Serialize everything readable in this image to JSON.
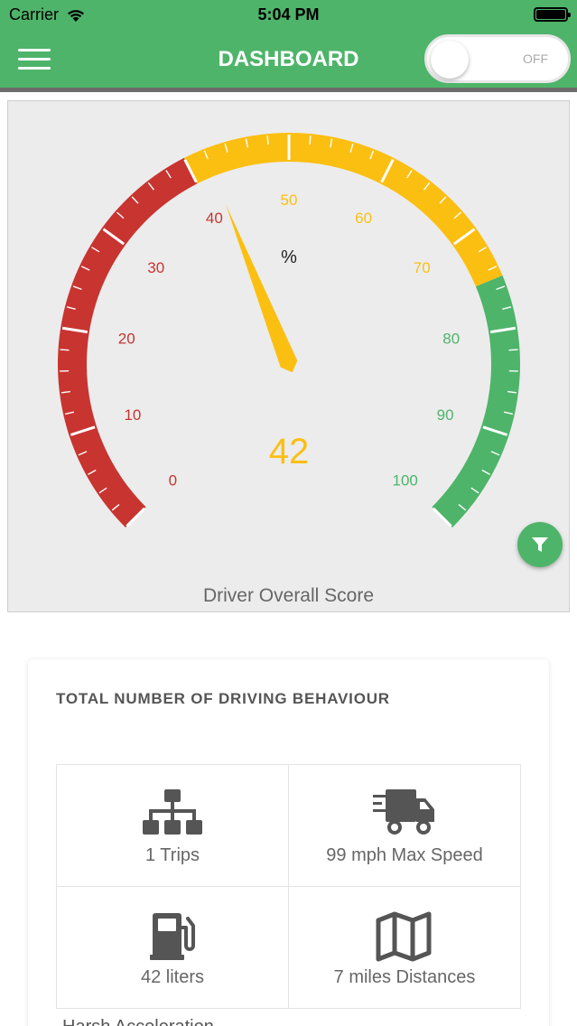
{
  "status_bar": {
    "carrier": "Carrier",
    "time": "5:04 PM"
  },
  "header": {
    "title": "DASHBOARD",
    "toggle_label": "OFF"
  },
  "gauge": {
    "value": 42,
    "value_text": "42",
    "unit": "%",
    "caption": "Driver Overall Score",
    "labels": [
      "0",
      "10",
      "20",
      "30",
      "40",
      "50",
      "60",
      "70",
      "80",
      "90",
      "100"
    ],
    "ranges": [
      {
        "from": 0,
        "to": 40,
        "color": "#c83430"
      },
      {
        "from": 40,
        "to": 75,
        "color": "#fbbf12"
      },
      {
        "from": 75,
        "to": 100,
        "color": "#4eb46a"
      }
    ]
  },
  "stats": {
    "title": "TOTAL NUMBER OF DRIVING BEHAVIOUR",
    "items": [
      {
        "icon": "sitemap-icon",
        "label": "1 Trips"
      },
      {
        "icon": "delivery-truck-icon",
        "label": "99 mph Max Speed"
      },
      {
        "icon": "fuel-pump-icon",
        "label": "42 liters"
      },
      {
        "icon": "map-icon",
        "label": "7 miles Distances"
      }
    ],
    "footer_label": "Harsh Acceleration"
  },
  "colors": {
    "brand_green": "#4eb46a",
    "red": "#c83430",
    "yellow": "#fbbf12"
  }
}
